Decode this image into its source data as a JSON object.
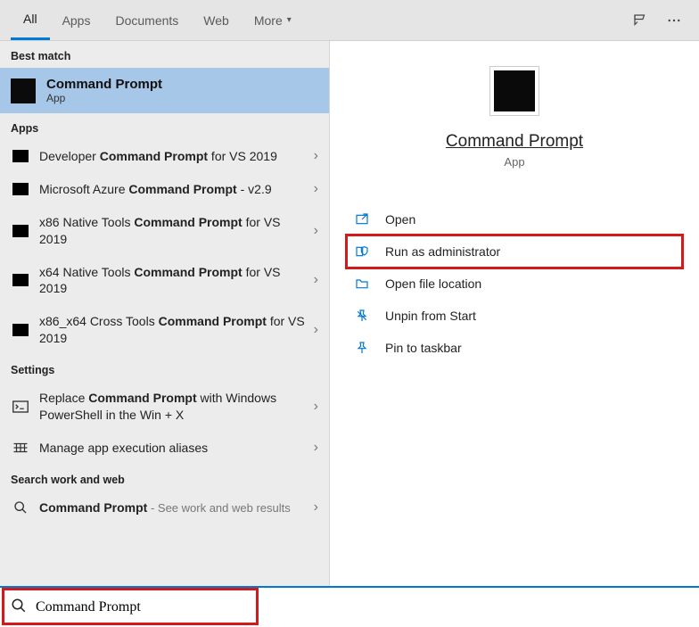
{
  "tabs": {
    "all": "All",
    "apps": "Apps",
    "documents": "Documents",
    "web": "Web",
    "more": "More"
  },
  "sections": {
    "best_match": "Best match",
    "apps": "Apps",
    "settings": "Settings",
    "web": "Search work and web"
  },
  "best": {
    "title": "Command Prompt",
    "sub": "App"
  },
  "apps_list": [
    {
      "pre": "Developer ",
      "bold": "Command Prompt",
      "post": " for VS 2019"
    },
    {
      "pre": "Microsoft Azure ",
      "bold": "Command Prompt",
      "post": " - v2.9"
    },
    {
      "pre": "x86 Native Tools ",
      "bold": "Command Prompt",
      "post": " for VS 2019"
    },
    {
      "pre": "x64 Native Tools ",
      "bold": "Command Prompt",
      "post": " for VS 2019"
    },
    {
      "pre": "x86_x64 Cross Tools ",
      "bold": "Command",
      "post1": " ",
      "bold2": "Prompt",
      "post2": " for VS 2019"
    }
  ],
  "settings_list": [
    {
      "pre": "Replace ",
      "bold": "Command Prompt",
      "post": " with Windows PowerShell in the Win + X"
    },
    {
      "text": "Manage app execution aliases"
    }
  ],
  "web_list": [
    {
      "bold": "Command Prompt",
      "hint": " - See work and web results"
    }
  ],
  "preview": {
    "title": "Command Prompt",
    "sub": "App"
  },
  "actions": {
    "open": "Open",
    "run_admin": "Run as administrator",
    "open_loc": "Open file location",
    "unpin": "Unpin from Start",
    "pin_tb": "Pin to taskbar"
  },
  "search": {
    "value": "Command Prompt"
  }
}
